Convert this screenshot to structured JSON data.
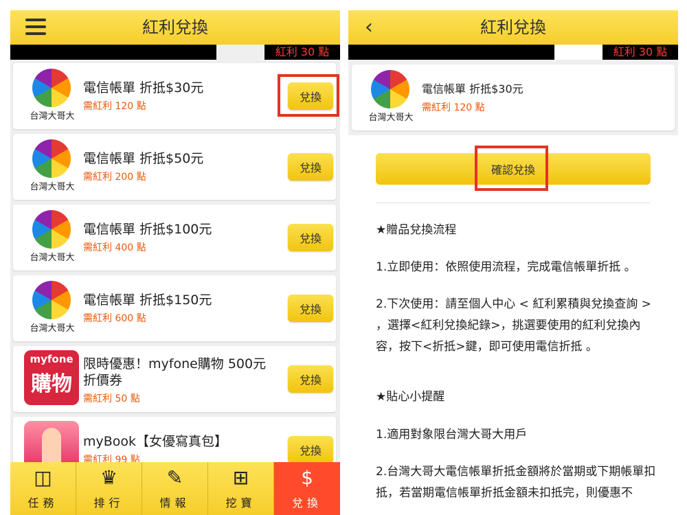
{
  "left": {
    "title": "紅利兌換",
    "bonus_label": "紅利 30 點",
    "items": [
      {
        "logo": "台灣大哥大",
        "name": "電信帳單 折抵$30元",
        "need": "需紅利 120 點",
        "button": "兌換"
      },
      {
        "logo": "台灣大哥大",
        "name": "電信帳單 折抵$50元",
        "need": "需紅利 200 點",
        "button": "兌換"
      },
      {
        "logo": "台灣大哥大",
        "name": "電信帳單 折抵$100元",
        "need": "需紅利 400 點",
        "button": "兌換"
      },
      {
        "logo": "台灣大哥大",
        "name": "電信帳單 折抵$150元",
        "need": "需紅利 600 點",
        "button": "兌換"
      },
      {
        "logo_top": "myfone",
        "logo_main": "購物",
        "name": "限時優惠！myfone購物 500元折價券",
        "need": "需紅利 50 點",
        "button": "兌換"
      },
      {
        "name": "myBook【女優寫真包】",
        "need": "需紅利 99 點",
        "button": "兌換"
      }
    ],
    "tabs": [
      {
        "label": "任務",
        "icon": "briefcase-icon",
        "glyph": "◫"
      },
      {
        "label": "排行",
        "icon": "crown-icon",
        "glyph": "♛"
      },
      {
        "label": "情報",
        "icon": "new-tag-icon",
        "glyph": "✎"
      },
      {
        "label": "挖寶",
        "icon": "gift-icon",
        "glyph": "⊞"
      },
      {
        "label": "兌換",
        "icon": "money-bag-icon",
        "glyph": "$"
      }
    ]
  },
  "right": {
    "title": "紅利兌換",
    "bonus_label": "紅利 30 點",
    "item": {
      "logo": "台灣大哥大",
      "name": "電信帳單 折抵$30元",
      "need": "需紅利 120 點"
    },
    "confirm_label": "確認兌換",
    "heading1": "★贈品兌換流程",
    "step1": "1.立即使用：依照使用流程，完成電信帳單折抵 。",
    "step2": "2.下次使用：請至個人中心 < 紅利累積與兌換查詢 > ，選擇<紅利兌換紀錄>，挑選要使用的紅利兌換內容，按下<折抵>鍵，即可使用電信折抵 。",
    "heading2": "★貼心小提醒",
    "tip1": "1.適用對象限台灣大哥大用戶",
    "tip2": "2.台灣大哥大電信帳單折抵金額將於當期或下期帳單扣抵，若當期電信帳單折抵金額未扣抵完，則優惠不"
  },
  "colors": {
    "accent_yellow": "#f6ce2b",
    "highlight_red": "#e53222",
    "need_orange": "#e8580c",
    "active_tab": "#ff4b2b"
  }
}
